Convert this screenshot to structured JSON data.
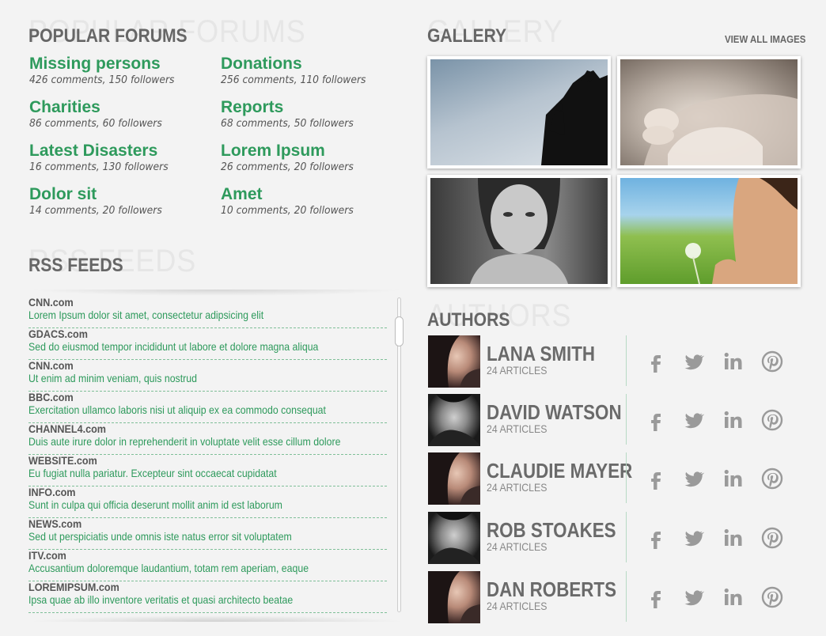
{
  "forums": {
    "ghost": "POPULAR FORUMS",
    "title": "POPULAR FORUMS",
    "items": [
      {
        "name": "Missing persons",
        "meta": "426 comments, 150 followers"
      },
      {
        "name": "Donations",
        "meta": "256 comments, 110 followers"
      },
      {
        "name": "Charities",
        "meta": "86 comments, 60 followers"
      },
      {
        "name": "Reports",
        "meta": "68 comments, 50 followers"
      },
      {
        "name": "Latest Disasters",
        "meta": "16 comments, 130 followers"
      },
      {
        "name": "Lorem Ipsum",
        "meta": "26 comments, 20 followers"
      },
      {
        "name": "Dolor sit",
        "meta": "14 comments, 20 followers"
      },
      {
        "name": "Amet",
        "meta": "10 comments, 20 followers"
      }
    ]
  },
  "rss": {
    "ghost": "RSS FEEDS",
    "title": "RSS FEEDS",
    "items": [
      {
        "source": "CNN.com",
        "text": "Lorem Ipsum dolor sit amet, consectetur adipsicing elit"
      },
      {
        "source": "GDACS.com",
        "text": "Sed do eiusmod tempor incididunt ut labore et dolore magna aliqua"
      },
      {
        "source": "CNN.com",
        "text": "Ut enim ad minim veniam, quis nostrud"
      },
      {
        "source": "BBC.com",
        "text": "Exercitation ullamco laboris nisi ut aliquip ex ea commodo consequat"
      },
      {
        "source": "CHANNEL4.com",
        "text": "Duis aute irure dolor in reprehenderit in voluptate velit esse cillum dolore"
      },
      {
        "source": "WEBSITE.com",
        "text": "Eu fugiat nulla pariatur. Excepteur sint occaecat cupidatat"
      },
      {
        "source": "INFO.com",
        "text": "Sunt in culpa qui officia deserunt mollit anim id est laborum"
      },
      {
        "source": "NEWS.com",
        "text": "Sed ut perspiciatis unde omnis iste natus error sit voluptatem"
      },
      {
        "source": "ITV.com",
        "text": "Accusantium doloremque laudantium, totam rem aperiam, eaque"
      },
      {
        "source": "LOREMIPSUM.com",
        "text": "Ipsa quae ab illo inventore veritatis et quasi architecto beatae"
      }
    ]
  },
  "gallery": {
    "ghost": "GALLERY",
    "title": "GALLERY",
    "view_all": "VIEW ALL IMAGES"
  },
  "authors": {
    "ghost": "AUTHORS",
    "title": "AUTHORS",
    "items": [
      {
        "name": "LANA SMITH",
        "articles": "24 ARTICLES"
      },
      {
        "name": "DAVID WATSON",
        "articles": "24 ARTICLES"
      },
      {
        "name": "CLAUDIE MAYER",
        "articles": "24 ARTICLES"
      },
      {
        "name": "ROB STOAKES",
        "articles": "24 ARTICLES"
      },
      {
        "name": "DAN ROBERTS",
        "articles": "24 ARTICLES"
      }
    ]
  },
  "colors": {
    "accent_green": "#2e9a5c",
    "text_gray": "#666666",
    "ghost_gray": "#e6e6e6",
    "icon_gray": "#9a9a9a"
  },
  "icons": [
    "facebook-icon",
    "twitter-icon",
    "linkedin-icon",
    "pinterest-icon"
  ]
}
